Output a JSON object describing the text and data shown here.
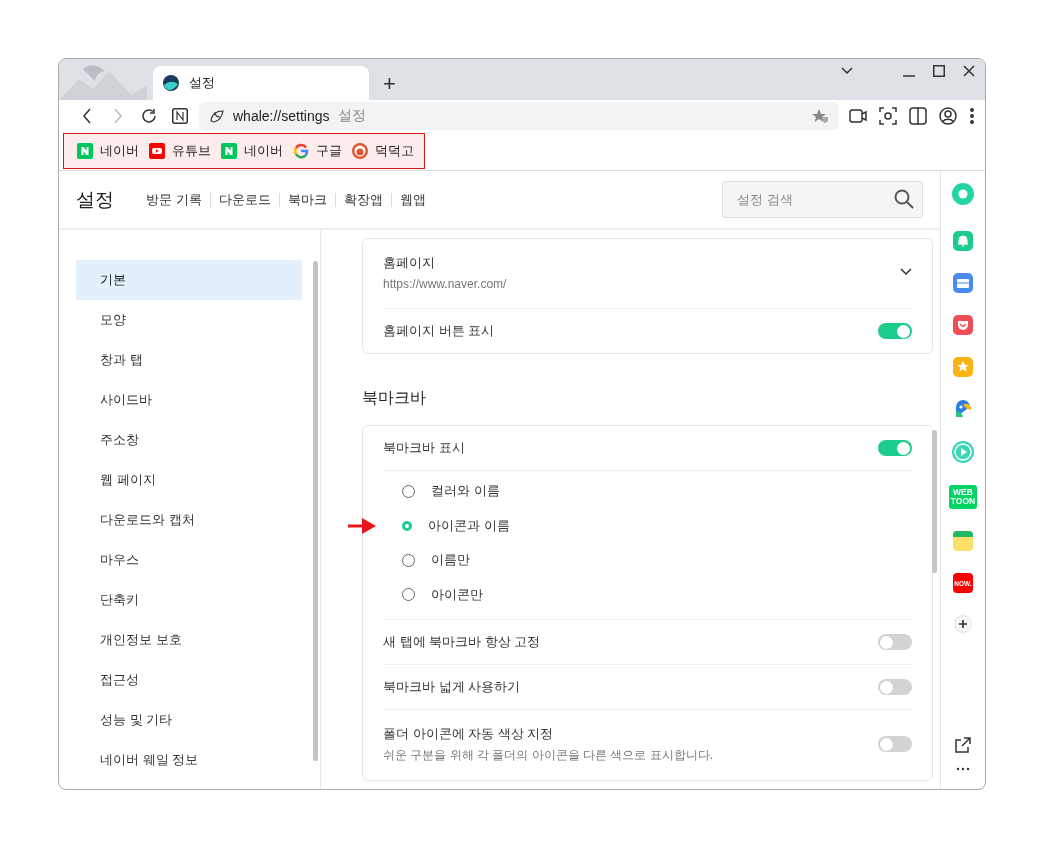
{
  "tab": {
    "title": "설정",
    "new_tab": "+"
  },
  "address_bar": {
    "url": "whale://settings",
    "page_title": "설정"
  },
  "bookmark_bar": {
    "highlighted": true,
    "items": [
      {
        "label": "네이버",
        "kind": "naver"
      },
      {
        "label": "유튜브",
        "kind": "youtube"
      },
      {
        "label": "네이버",
        "kind": "naver"
      },
      {
        "label": "구글",
        "kind": "google"
      },
      {
        "label": "덕덕고",
        "kind": "duck"
      }
    ]
  },
  "header": {
    "title": "설정",
    "links": [
      "방문 기록",
      "다운로드",
      "북마크",
      "확장앱",
      "웹앱"
    ],
    "search": {
      "placeholder": "설정 검색"
    }
  },
  "nav": {
    "items": [
      {
        "label": "기본",
        "selected": true
      },
      {
        "label": "모양",
        "selected": false
      },
      {
        "label": "창과 탭",
        "selected": false
      },
      {
        "label": "사이드바",
        "selected": false
      },
      {
        "label": "주소창",
        "selected": false
      },
      {
        "label": "웹 페이지",
        "selected": false
      },
      {
        "label": "다운로드와 캡처",
        "selected": false
      },
      {
        "label": "마우스",
        "selected": false
      },
      {
        "label": "단축키",
        "selected": false
      },
      {
        "label": "개인정보 보호",
        "selected": false
      },
      {
        "label": "접근성",
        "selected": false
      },
      {
        "label": "성능 및 기타",
        "selected": false
      },
      {
        "label": "네이버 웨일 정보",
        "selected": false
      }
    ]
  },
  "homepage_card": {
    "rows": [
      {
        "kind": "dropdown",
        "label": "홈페이지",
        "value": "https://www.naver.com/"
      },
      {
        "kind": "toggle",
        "label": "홈페이지 버튼 표시",
        "on": true
      }
    ]
  },
  "bookmark_section": {
    "title": "북마크바",
    "rows": [
      {
        "kind": "toggle",
        "label": "북마크바 표시",
        "on": true
      },
      {
        "kind": "radios",
        "options": [
          {
            "label": "컬러와 이름",
            "selected": false,
            "marked": false
          },
          {
            "label": "아이콘과 이름",
            "selected": true,
            "marked": true
          },
          {
            "label": "이름만",
            "selected": false,
            "marked": false
          },
          {
            "label": "아이콘만",
            "selected": false,
            "marked": false
          }
        ]
      },
      {
        "kind": "toggle",
        "label": "새 탭에 북마크바 항상 고정",
        "on": false
      },
      {
        "kind": "toggle",
        "label": "북마크바 넓게 사용하기",
        "on": false
      },
      {
        "kind": "toggle",
        "label": "폴더 아이콘에 자동 색상 지정",
        "description": "쉬운 구분을 위해 각 폴더의 아이콘을 다른 색으로 표시합니다.",
        "on": false
      }
    ]
  },
  "side_apps": [
    {
      "kind": "ring"
    },
    {
      "kind": "bell"
    },
    {
      "kind": "briefcase"
    },
    {
      "kind": "pocket"
    },
    {
      "kind": "star"
    },
    {
      "kind": "bird"
    },
    {
      "kind": "play"
    },
    {
      "kind": "badge",
      "text": "WEB TOON"
    },
    {
      "kind": "memo"
    },
    {
      "kind": "tile",
      "text": "NOW."
    },
    {
      "kind": "add"
    }
  ]
}
